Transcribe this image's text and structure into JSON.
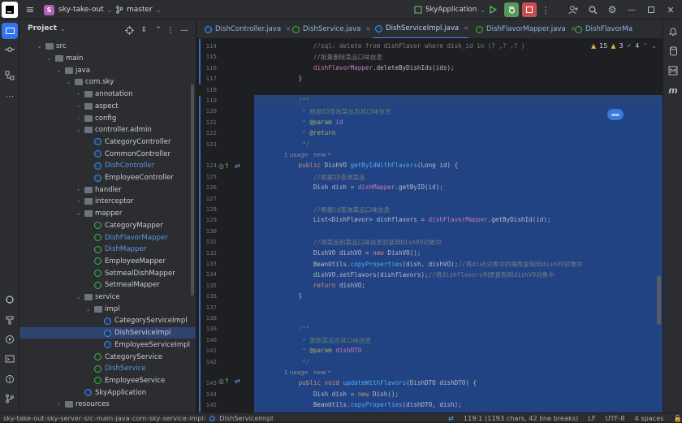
{
  "toolbar": {
    "menu": "≡",
    "project_badge": "S",
    "project": "sky-take-out",
    "branch": "master",
    "run_config": "SkyApplication"
  },
  "project_panel": {
    "title": "Project"
  },
  "tree": [
    {
      "label": "src",
      "type": "folder",
      "arrow": "⌄",
      "indent": 1
    },
    {
      "label": "main",
      "type": "folder",
      "arrow": "⌄",
      "indent": 2
    },
    {
      "label": "java",
      "type": "folder",
      "arrow": "⌄",
      "indent": 3
    },
    {
      "label": "com.sky",
      "type": "folder",
      "arrow": "⌄",
      "indent": 4
    },
    {
      "label": "annotation",
      "type": "folder",
      "arrow": "›",
      "indent": 5
    },
    {
      "label": "aspect",
      "type": "folder",
      "arrow": "›",
      "indent": 5
    },
    {
      "label": "config",
      "type": "folder",
      "arrow": "›",
      "indent": 5
    },
    {
      "label": "controller.admin",
      "type": "folder",
      "arrow": "⌄",
      "indent": 5
    },
    {
      "label": "CategoryController",
      "type": "class",
      "indent": 6
    },
    {
      "label": "CommonController",
      "type": "class",
      "indent": 6
    },
    {
      "label": "DishController",
      "type": "class",
      "indent": 6,
      "color": "#5d95e0"
    },
    {
      "label": "EmployeeController",
      "type": "class",
      "indent": 6
    },
    {
      "label": "handler",
      "type": "folder",
      "arrow": "›",
      "indent": 5
    },
    {
      "label": "interceptor",
      "type": "folder",
      "arrow": "›",
      "indent": 5
    },
    {
      "label": "mapper",
      "type": "folder",
      "arrow": "⌄",
      "indent": 5
    },
    {
      "label": "CategoryMapper",
      "type": "intf",
      "indent": 6
    },
    {
      "label": "DishFlavorMapper",
      "type": "intf",
      "indent": 6,
      "color": "#5d95e0"
    },
    {
      "label": "DishMapper",
      "type": "intf",
      "indent": 6,
      "color": "#5d95e0"
    },
    {
      "label": "EmployeeMapper",
      "type": "intf",
      "indent": 6
    },
    {
      "label": "SetmealDishMapper",
      "type": "intf",
      "indent": 6
    },
    {
      "label": "SetmealMapper",
      "type": "intf",
      "indent": 6
    },
    {
      "label": "service",
      "type": "folder",
      "arrow": "⌄",
      "indent": 5
    },
    {
      "label": "impl",
      "type": "folder",
      "arrow": "⌄",
      "indent": 6
    },
    {
      "label": "CategoryServiceImpl",
      "type": "class",
      "indent": 7
    },
    {
      "label": "DishServiceImpl",
      "type": "class",
      "indent": 7,
      "selected": true
    },
    {
      "label": "EmployeeServiceImpl",
      "type": "class",
      "indent": 7
    },
    {
      "label": "CategoryService",
      "type": "intf",
      "indent": 6
    },
    {
      "label": "DishService",
      "type": "intf",
      "indent": 6,
      "color": "#5d95e0"
    },
    {
      "label": "EmployeeService",
      "type": "intf",
      "indent": 6
    },
    {
      "label": "SkyApplication",
      "type": "class",
      "indent": 5
    },
    {
      "label": "resources",
      "type": "folder",
      "arrow": "›",
      "indent": 3
    }
  ],
  "tabs": [
    {
      "label": "DishController.java",
      "active": false
    },
    {
      "label": "DishService.java",
      "active": false
    },
    {
      "label": "DishServiceImpl.java",
      "active": true
    },
    {
      "label": "DishFlavorMapper.java",
      "active": false
    },
    {
      "label": "DishFlavorMa",
      "active": false
    }
  ],
  "inspections": {
    "warnings": "15",
    "weak": "3",
    "typos": "4"
  },
  "line_numbers": [
    "114",
    "115",
    "116",
    "117",
    "118",
    "119",
    "120",
    "121",
    "122",
    "123",
    "",
    "124",
    "125",
    "126",
    "127",
    "128",
    "129",
    "130",
    "131",
    "132",
    "133",
    "134",
    "135",
    "136",
    "137",
    "138",
    "139",
    "140",
    "141",
    "142",
    "",
    "143",
    "144",
    "145"
  ],
  "code_lines": [
    [
      {
        "c": "c",
        "t": "            //sql: delete from dishFlavor where dish_id in (? ,? ,? )"
      }
    ],
    [
      {
        "c": "c",
        "t": "            //批量删除菜品口味信息"
      }
    ],
    [
      {
        "c": "t",
        "t": "            "
      },
      {
        "c": "m",
        "t": "dishFlavorMapper"
      },
      {
        "c": "t",
        "t": ".deleteByDishIds(ids);"
      }
    ],
    [
      {
        "c": "t",
        "t": "        }"
      }
    ],
    [
      {
        "c": "t",
        "t": ""
      }
    ],
    [
      {
        "c": "d",
        "t": "        /**"
      }
    ],
    [
      {
        "c": "d",
        "t": "         * 根据ID查询菜品及其口味信息"
      }
    ],
    [
      {
        "c": "d",
        "t": "         * "
      },
      {
        "c": "an",
        "t": "@param"
      },
      {
        "c": "d",
        "t": " "
      },
      {
        "c": "m",
        "t": "id"
      }
    ],
    [
      {
        "c": "d",
        "t": "         * "
      },
      {
        "c": "an",
        "t": "@return"
      }
    ],
    [
      {
        "c": "d",
        "t": "         */"
      }
    ],
    [
      {
        "c": "u",
        "t": "        1 usage   new *"
      }
    ],
    [
      {
        "c": "k",
        "t": "        public "
      },
      {
        "c": "t",
        "t": "DishVO "
      },
      {
        "c": "f",
        "t": "getByIdWithFlavors"
      },
      {
        "c": "t",
        "t": "(Long id) {"
      }
    ],
    [
      {
        "c": "c",
        "t": "            //根据ID查询菜品"
      }
    ],
    [
      {
        "c": "t",
        "t": "            Dish dish = "
      },
      {
        "c": "m",
        "t": "dishMapper"
      },
      {
        "c": "t",
        "t": ".getByID(id);"
      }
    ],
    [
      {
        "c": "t",
        "t": ""
      }
    ],
    [
      {
        "c": "c",
        "t": "            //根据id查询菜品口味信息"
      }
    ],
    [
      {
        "c": "t",
        "t": "            List<DishFlavor> "
      },
      {
        "c": "t",
        "t": "dishflavors"
      },
      {
        "c": "t",
        "t": " = "
      },
      {
        "c": "m",
        "t": "dishFlavorMapper"
      },
      {
        "c": "t",
        "t": ".getByDishId(id);"
      }
    ],
    [
      {
        "c": "t",
        "t": ""
      }
    ],
    [
      {
        "c": "c",
        "t": "            //将菜品和菜品口味信息封装到DishVO对象中"
      }
    ],
    [
      {
        "c": "t",
        "t": "            DishVO dishVO = "
      },
      {
        "c": "k",
        "t": "new "
      },
      {
        "c": "t",
        "t": "DishVO();"
      }
    ],
    [
      {
        "c": "t",
        "t": "            BeanUtils."
      },
      {
        "c": "f",
        "t": "copyProperties"
      },
      {
        "c": "t",
        "t": "(dish, dishVO);"
      },
      {
        "c": "c",
        "t": "//将dish对象中的属性复制到dishVO对象中"
      }
    ],
    [
      {
        "c": "t",
        "t": "            dishVO.setFlavors(dishflavors);"
      },
      {
        "c": "c",
        "t": "//将dishflavors列表复制到dishVO对象中"
      }
    ],
    [
      {
        "c": "k",
        "t": "            return "
      },
      {
        "c": "t",
        "t": "dishVO;"
      }
    ],
    [
      {
        "c": "t",
        "t": "        }"
      }
    ],
    [
      {
        "c": "t",
        "t": ""
      }
    ],
    [
      {
        "c": "t",
        "t": ""
      }
    ],
    [
      {
        "c": "d",
        "t": "        /**"
      }
    ],
    [
      {
        "c": "d",
        "t": "         * 更新菜品及其口味信息"
      }
    ],
    [
      {
        "c": "d",
        "t": "         * "
      },
      {
        "c": "an",
        "t": "@param"
      },
      {
        "c": "d",
        "t": " "
      },
      {
        "c": "m",
        "t": "dishDTO"
      }
    ],
    [
      {
        "c": "d",
        "t": "         */"
      }
    ],
    [
      {
        "c": "u",
        "t": "        1 usage   new *"
      }
    ],
    [
      {
        "c": "k",
        "t": "        public void "
      },
      {
        "c": "f",
        "t": "updateWithFlavors"
      },
      {
        "c": "t",
        "t": "(DishDTO dishDTO) {"
      }
    ],
    [
      {
        "c": "t",
        "t": "            Dish dish = "
      },
      {
        "c": "k",
        "t": "new "
      },
      {
        "c": "t",
        "t": "Dish();"
      }
    ],
    [
      {
        "c": "t",
        "t": "            BeanUtils."
      },
      {
        "c": "f",
        "t": "copyProperties"
      },
      {
        "c": "t",
        "t": "(dishDTO, dish);"
      }
    ]
  ],
  "status_bar": {
    "breadcrumbs": [
      "sky-take-out",
      "sky-server",
      "src",
      "main",
      "java",
      "com",
      "sky",
      "service",
      "impl",
      "DishServiceImpl"
    ],
    "position": "119:1 (1193 chars, 42 line breaks)",
    "line_sep": "LF",
    "encoding": "UTF-8",
    "indent": "4 spaces"
  }
}
